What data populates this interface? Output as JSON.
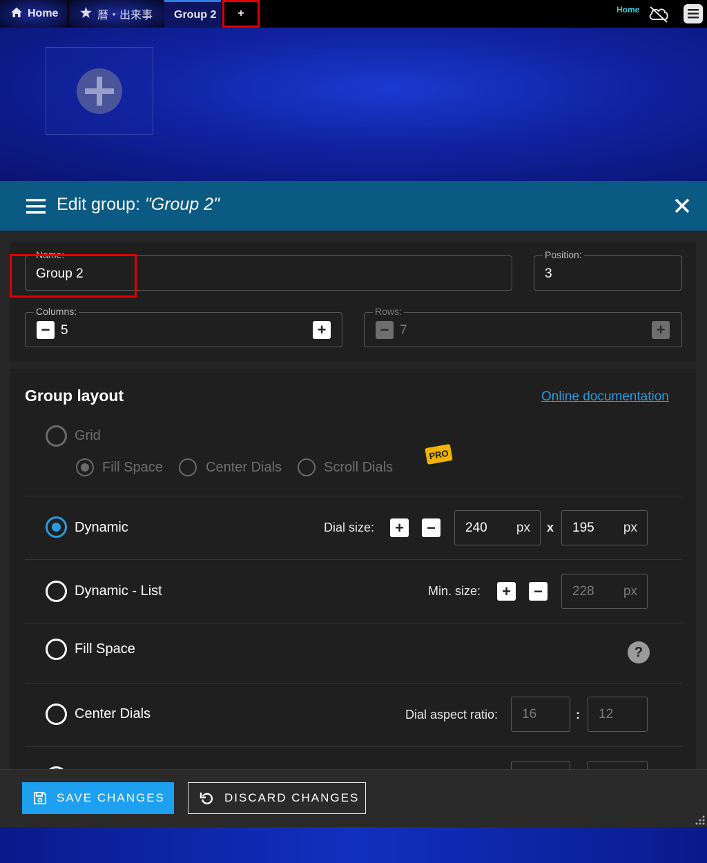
{
  "tabs": [
    {
      "label": "Home",
      "icon": "home-icon"
    },
    {
      "label": "暦・出来事",
      "icon": "star-icon"
    },
    {
      "label": "Group 2"
    },
    {
      "label": "+"
    }
  ],
  "topbar": {
    "home_label": "Home"
  },
  "edit": {
    "title_prefix": "Edit group:",
    "group_name_display": "\"Group 2\""
  },
  "form": {
    "name_label": "Name:",
    "name_value": "Group 2",
    "position_label": "Position:",
    "position_value": "3",
    "columns_label": "Columns:",
    "columns_value": "5",
    "rows_label": "Rows:",
    "rows_value": "7"
  },
  "layout": {
    "title": "Group layout",
    "doc_link": "Online documentation",
    "grid_label": "Grid",
    "grid_sub": [
      "Fill Space",
      "Center Dials",
      "Scroll Dials"
    ],
    "pro_badge": "PRO",
    "dynamic_label": "Dynamic",
    "dial_size_label": "Dial size:",
    "dial_width": "240",
    "dial_height": "195",
    "unit": "px",
    "x_sep": "x",
    "dynamic_list_label": "Dynamic - List",
    "min_size_label": "Min. size:",
    "min_size": "228",
    "fill_space_label": "Fill Space",
    "center_dials_label": "Center Dials",
    "aspect_label": "Dial aspect ratio:",
    "aspect_w": "16",
    "aspect_h": "12",
    "colon": ":",
    "help": "?"
  },
  "footer": {
    "save_label": "SAVE CHANGES",
    "discard_label": "DISCARD CHANGES"
  },
  "colors": {
    "accent": "#1ea0f0",
    "header": "#0b5a84",
    "highlight": "#e00000"
  }
}
